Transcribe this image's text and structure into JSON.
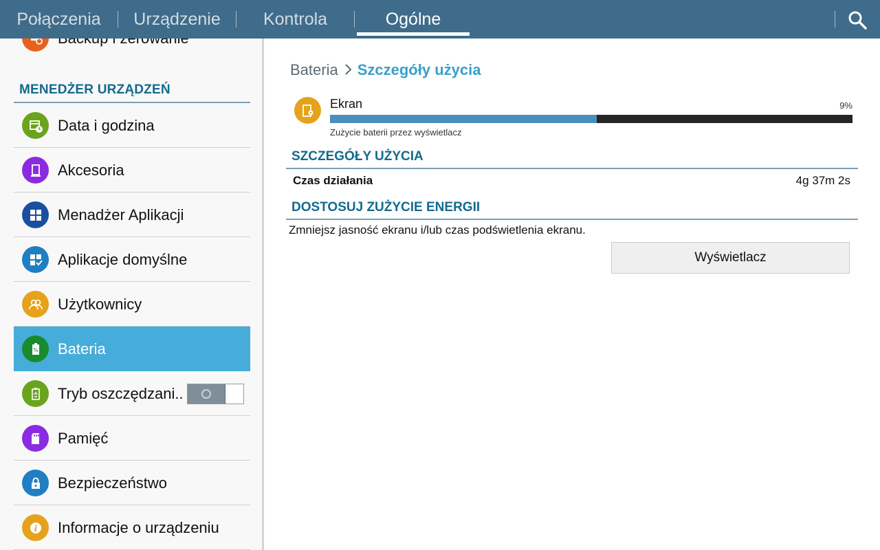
{
  "tabs": [
    {
      "label": "Połączenia",
      "active": false
    },
    {
      "label": "Urządzenie",
      "active": false
    },
    {
      "label": "Kontrola",
      "active": false
    },
    {
      "label": "Ogólne",
      "active": true
    }
  ],
  "search_icon": "search-icon",
  "sidebar": {
    "section_header": "MENEDŻER URZĄDZEŃ",
    "top_item": {
      "label": "Backup i zerowanie",
      "icon": "backup-icon",
      "color": "#e8611c"
    },
    "items": [
      {
        "label": "Data i godzina",
        "icon": "calendar-clock-icon",
        "color": "#6aa41c"
      },
      {
        "label": "Akcesoria",
        "icon": "tablet-icon",
        "color": "#8a2be2"
      },
      {
        "label": "Menadżer Aplikacji",
        "icon": "grid-icon",
        "color": "#1a4fa0"
      },
      {
        "label": "Aplikacje domyślne",
        "icon": "grid-check-icon",
        "color": "#1f7fc2"
      },
      {
        "label": "Użytkownicy",
        "icon": "users-icon",
        "color": "#e5a21a"
      },
      {
        "label": "Bateria",
        "icon": "battery-icon",
        "color": "#1a8a2e",
        "selected": true
      },
      {
        "label": "Tryb oszczędzani..",
        "icon": "recycle-icon",
        "color": "#6aa41c",
        "toggle": true,
        "toggle_on": false
      },
      {
        "label": "Pamięć",
        "icon": "sd-card-icon",
        "color": "#8a2be2"
      },
      {
        "label": "Bezpieczeństwo",
        "icon": "lock-icon",
        "color": "#1f7fc2"
      },
      {
        "label": "Informacje o urządzeniu",
        "icon": "info-icon",
        "color": "#e5a21a"
      }
    ]
  },
  "main": {
    "breadcrumb": {
      "parent": "Bateria",
      "current": "Szczegóły użycia"
    },
    "usage": {
      "name": "Ekran",
      "percent_label": "9%",
      "bar_fill_fraction": 0.51,
      "description": "Zużycie baterii przez wyświetlacz",
      "icon": "screen-settings-icon",
      "fill_color": "#4a8ebd"
    },
    "details_title": "SZCZEGÓŁY UŻYCIA",
    "details": [
      {
        "key": "Czas działania",
        "value": "4g 37m 2s"
      }
    ],
    "adjust_title": "DOSTOSUJ ZUŻYCIE ENERGII",
    "adjust_text": "Zmniejsz jasność ekranu i/lub czas podświetlenia ekranu.",
    "display_button": "Wyświetlacz"
  },
  "colors": {
    "topbar": "#3f6c8a",
    "accent": "#146a8e",
    "selected": "#46acd9",
    "breadcrumb_current": "#3aa0c8"
  }
}
